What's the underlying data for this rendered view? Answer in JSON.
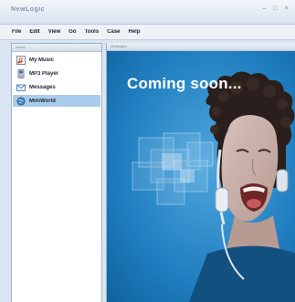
{
  "window": {
    "title": "NewLogic",
    "controls": [
      "–",
      "□",
      "×"
    ]
  },
  "menu": [
    {
      "label": "File"
    },
    {
      "label": "Edit"
    },
    {
      "label": "View"
    },
    {
      "label": "Go"
    },
    {
      "label": "Tools"
    },
    {
      "label": "Case"
    },
    {
      "label": "Help"
    }
  ],
  "left_panel": {
    "header": "Views",
    "items": [
      {
        "label": "My Music",
        "icon": "music-note-icon",
        "selected": false
      },
      {
        "label": "MP3 Player",
        "icon": "mp3-player-icon",
        "selected": false
      },
      {
        "label": "Messages",
        "icon": "messages-icon",
        "selected": false
      },
      {
        "label": "MiniWorld",
        "icon": "miniworld-icon",
        "selected": true
      }
    ]
  },
  "right_panel": {
    "header": "Messages",
    "banner_text": "Coming soon..."
  },
  "colors": {
    "accent": "#1d7fc1",
    "selection": "#aacbea",
    "banner_text": "#ffffff"
  }
}
